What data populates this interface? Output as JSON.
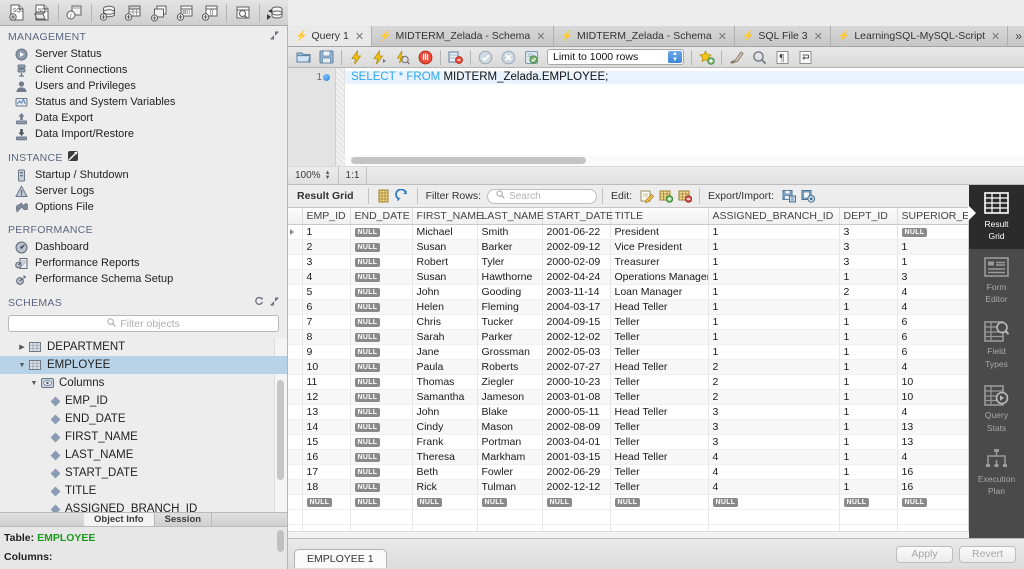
{
  "main_toolbar": {
    "icons": [
      {
        "name": "new-sql-file-icon",
        "label": "New SQL File"
      },
      {
        "name": "open-sql-file-icon",
        "label": "Open SQL Script"
      },
      {
        "name": "connection-info-icon",
        "label": "Connection Info"
      },
      {
        "name": "add-schema-icon",
        "label": "Create New Schema"
      },
      {
        "name": "add-table-icon",
        "label": "Create New Table"
      },
      {
        "name": "add-view-icon",
        "label": "Create New View"
      },
      {
        "name": "add-procedure-icon",
        "label": "Create New Procedure"
      },
      {
        "name": "add-function-icon",
        "label": "Create New Function"
      },
      {
        "name": "search-data-icon",
        "label": "Search Table Data"
      },
      {
        "name": "reconnect-server-icon",
        "label": "Reconnect to Server"
      }
    ]
  },
  "sidebar": {
    "management": {
      "title": "MANAGEMENT",
      "items": [
        {
          "label": "Server Status",
          "icon": "server-status-icon"
        },
        {
          "label": "Client Connections",
          "icon": "client-connections-icon"
        },
        {
          "label": "Users and Privileges",
          "icon": "users-privileges-icon"
        },
        {
          "label": "Status and System Variables",
          "icon": "status-variables-icon"
        },
        {
          "label": "Data Export",
          "icon": "data-export-icon"
        },
        {
          "label": "Data Import/Restore",
          "icon": "data-import-icon"
        }
      ]
    },
    "instance": {
      "title": "INSTANCE",
      "items": [
        {
          "label": "Startup / Shutdown",
          "icon": "startup-shutdown-icon"
        },
        {
          "label": "Server Logs",
          "icon": "server-logs-icon"
        },
        {
          "label": "Options File",
          "icon": "options-file-icon"
        }
      ]
    },
    "performance": {
      "title": "PERFORMANCE",
      "items": [
        {
          "label": "Dashboard",
          "icon": "dashboard-icon"
        },
        {
          "label": "Performance Reports",
          "icon": "performance-reports-icon"
        },
        {
          "label": "Performance Schema Setup",
          "icon": "performance-schema-icon"
        }
      ]
    },
    "schemas": {
      "title": "SCHEMAS",
      "filter_placeholder": "Filter objects",
      "tree": [
        {
          "label": "DEPARTMENT",
          "type": "table",
          "indent": 1,
          "expanded": false,
          "selected": false
        },
        {
          "label": "EMPLOYEE",
          "type": "table",
          "indent": 1,
          "expanded": true,
          "selected": true
        },
        {
          "label": "Columns",
          "type": "folder",
          "indent": 2,
          "expanded": true,
          "selected": false
        },
        {
          "label": "EMP_ID",
          "type": "column",
          "indent": 3,
          "selected": false
        },
        {
          "label": "END_DATE",
          "type": "column",
          "indent": 3,
          "selected": false
        },
        {
          "label": "FIRST_NAME",
          "type": "column",
          "indent": 3,
          "selected": false
        },
        {
          "label": "LAST_NAME",
          "type": "column",
          "indent": 3,
          "selected": false
        },
        {
          "label": "START_DATE",
          "type": "column",
          "indent": 3,
          "selected": false
        },
        {
          "label": "TITLE",
          "type": "column",
          "indent": 3,
          "selected": false
        },
        {
          "label": "ASSIGNED_BRANCH_ID",
          "type": "column",
          "indent": 3,
          "selected": false
        }
      ]
    },
    "bottom_tabs": [
      {
        "label": "Object Info",
        "active": true
      },
      {
        "label": "Session",
        "active": false
      }
    ],
    "object_info": {
      "table_label": "Table:",
      "table_name": "EMPLOYEE",
      "columns_label": "Columns:"
    }
  },
  "editor_tabs": [
    {
      "label": "Query 1",
      "active": true,
      "closable": true
    },
    {
      "label": "MIDTERM_Zelada - Schema",
      "active": false,
      "closable": true
    },
    {
      "label": "MIDTERM_Zelada - Schema",
      "active": false,
      "closable": true
    },
    {
      "label": "SQL File 3",
      "active": false,
      "closable": true
    },
    {
      "label": "LearningSQL-MySQL-Script",
      "active": false,
      "closable": true
    }
  ],
  "tab_overflow": "»",
  "sql_toolbar": {
    "icons": [
      {
        "name": "open-file-icon"
      },
      {
        "name": "save-file-icon"
      },
      {
        "name": "execute-statement-icon"
      },
      {
        "name": "execute-current-icon"
      },
      {
        "name": "explain-query-icon"
      },
      {
        "name": "stop-execution-icon"
      },
      {
        "name": "toggle-stop-on-error-icon"
      },
      {
        "name": "commit-icon"
      },
      {
        "name": "rollback-icon"
      },
      {
        "name": "autocommit-icon"
      },
      {
        "name": "toggle-bookmark-icon"
      },
      {
        "name": "beautify-query-icon"
      },
      {
        "name": "find-icon"
      },
      {
        "name": "invisible-chars-icon"
      },
      {
        "name": "wrap-lines-icon"
      }
    ],
    "limit_value": "Limit to 1000 rows"
  },
  "sql_editor": {
    "line_number": "1",
    "query_keywords_1": "SELECT * FROM ",
    "query_rest": "MIDTERM_Zelada.EMPLOYEE;"
  },
  "zoom_bar": {
    "zoom": "100%",
    "ratio": "1:1"
  },
  "result_toolbar": {
    "title": "Result Grid",
    "filter_label": "Filter Rows:",
    "search_placeholder": "Search",
    "edit_label": "Edit:",
    "export_label": "Export/Import:",
    "icons": [
      {
        "name": "grid-view-icon"
      },
      {
        "name": "refresh-icon"
      },
      {
        "name": "edit-row-icon"
      },
      {
        "name": "insert-row-icon"
      },
      {
        "name": "delete-row-icon"
      },
      {
        "name": "export-recordset-icon"
      },
      {
        "name": "import-recordset-icon"
      },
      {
        "name": "wrap-cell-content-icon"
      }
    ]
  },
  "result_grid": {
    "columns": [
      "EMP_ID",
      "END_DATE",
      "FIRST_NAME",
      "LAST_NAME",
      "START_DATE",
      "TITLE",
      "ASSIGNED_BRANCH_ID",
      "DEPT_ID",
      "SUPERIOR_EMP_ID"
    ],
    "null_text": "NULL",
    "rows": [
      [
        "1",
        "NULL",
        "Michael",
        "Smith",
        "2001-06-22",
        "President",
        "1",
        "3",
        "NULL"
      ],
      [
        "2",
        "NULL",
        "Susan",
        "Barker",
        "2002-09-12",
        "Vice President",
        "1",
        "3",
        "1"
      ],
      [
        "3",
        "NULL",
        "Robert",
        "Tyler",
        "2000-02-09",
        "Treasurer",
        "1",
        "3",
        "1"
      ],
      [
        "4",
        "NULL",
        "Susan",
        "Hawthorne",
        "2002-04-24",
        "Operations Manager",
        "1",
        "1",
        "3"
      ],
      [
        "5",
        "NULL",
        "John",
        "Gooding",
        "2003-11-14",
        "Loan Manager",
        "1",
        "2",
        "4"
      ],
      [
        "6",
        "NULL",
        "Helen",
        "Fleming",
        "2004-03-17",
        "Head Teller",
        "1",
        "1",
        "4"
      ],
      [
        "7",
        "NULL",
        "Chris",
        "Tucker",
        "2004-09-15",
        "Teller",
        "1",
        "1",
        "6"
      ],
      [
        "8",
        "NULL",
        "Sarah",
        "Parker",
        "2002-12-02",
        "Teller",
        "1",
        "1",
        "6"
      ],
      [
        "9",
        "NULL",
        "Jane",
        "Grossman",
        "2002-05-03",
        "Teller",
        "1",
        "1",
        "6"
      ],
      [
        "10",
        "NULL",
        "Paula",
        "Roberts",
        "2002-07-27",
        "Head Teller",
        "2",
        "1",
        "4"
      ],
      [
        "11",
        "NULL",
        "Thomas",
        "Ziegler",
        "2000-10-23",
        "Teller",
        "2",
        "1",
        "10"
      ],
      [
        "12",
        "NULL",
        "Samantha",
        "Jameson",
        "2003-01-08",
        "Teller",
        "2",
        "1",
        "10"
      ],
      [
        "13",
        "NULL",
        "John",
        "Blake",
        "2000-05-11",
        "Head Teller",
        "3",
        "1",
        "4"
      ],
      [
        "14",
        "NULL",
        "Cindy",
        "Mason",
        "2002-08-09",
        "Teller",
        "3",
        "1",
        "13"
      ],
      [
        "15",
        "NULL",
        "Frank",
        "Portman",
        "2003-04-01",
        "Teller",
        "3",
        "1",
        "13"
      ],
      [
        "16",
        "NULL",
        "Theresa",
        "Markham",
        "2001-03-15",
        "Head Teller",
        "4",
        "1",
        "4"
      ],
      [
        "17",
        "NULL",
        "Beth",
        "Fowler",
        "2002-06-29",
        "Teller",
        "4",
        "1",
        "16"
      ],
      [
        "18",
        "NULL",
        "Rick",
        "Tulman",
        "2002-12-12",
        "Teller",
        "4",
        "1",
        "16"
      ],
      [
        "NULL",
        "NULL",
        "NULL",
        "NULL",
        "NULL",
        "NULL",
        "NULL",
        "NULL",
        "NULL"
      ]
    ]
  },
  "side_tabs": [
    {
      "label": "Result\nGrid",
      "line1": "Result",
      "line2": "Grid",
      "icon": "result-grid-icon",
      "active": true
    },
    {
      "label": "Form Editor",
      "line1": "Form",
      "line2": "Editor",
      "icon": "form-editor-icon",
      "active": false
    },
    {
      "label": "Field Types",
      "line1": "Field",
      "line2": "Types",
      "icon": "field-types-icon",
      "active": false
    },
    {
      "label": "Query Stats",
      "line1": "Query",
      "line2": "Stats",
      "icon": "query-stats-icon",
      "active": false
    },
    {
      "label": "Execution Plan",
      "line1": "Execution",
      "line2": "Plan",
      "icon": "execution-plan-icon",
      "active": false
    }
  ],
  "bottom_bar": {
    "result_tab": "EMPLOYEE 1",
    "apply_label": "Apply",
    "revert_label": "Revert"
  },
  "colors": {
    "accent_blue": "#2ca6f0",
    "selection_blue": "#b8d3e8",
    "selected_line": "#e8f3fd",
    "green_text": "#1a9b1a",
    "dark_panel": "#2b2b2b",
    "strip_gray": "#4a4a4a"
  }
}
